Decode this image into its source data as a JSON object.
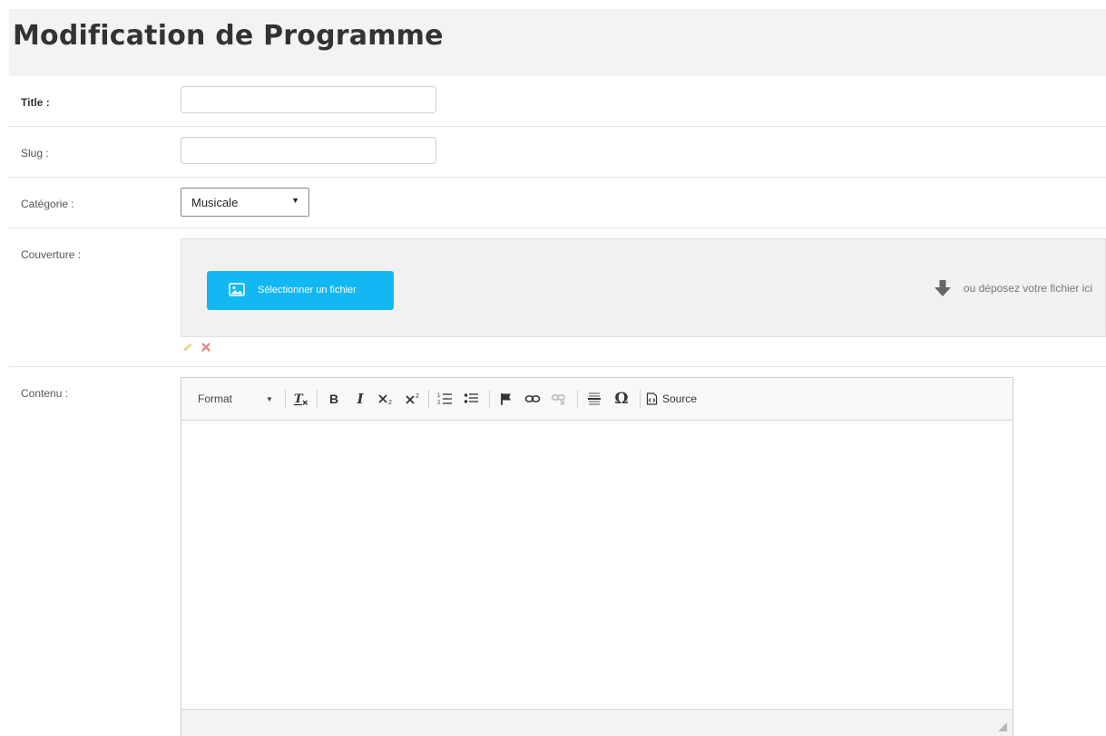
{
  "header": {
    "title": "Modification de Programme"
  },
  "form": {
    "title": {
      "label": "Title :",
      "value": "",
      "placeholder": ""
    },
    "slug": {
      "label": "Slug :",
      "value": "",
      "placeholder": ""
    },
    "category": {
      "label": "Catégorie :",
      "selected": "Musicale"
    },
    "cover": {
      "label": "Couverture :",
      "select_button": "Sélectionner un fichier",
      "drop_hint": "ou déposez votre fichier ici"
    },
    "content": {
      "label": "Contenu :",
      "toolbar": {
        "format_label": "Format",
        "bold": "B",
        "italic": "I",
        "source_label": "Source"
      },
      "body": ""
    }
  },
  "colors": {
    "header_bg": "#f3f3f3",
    "button_blue": "#12b8f2",
    "delete_red": "#e88a8a",
    "pencil_orange": "#f0c26a"
  }
}
